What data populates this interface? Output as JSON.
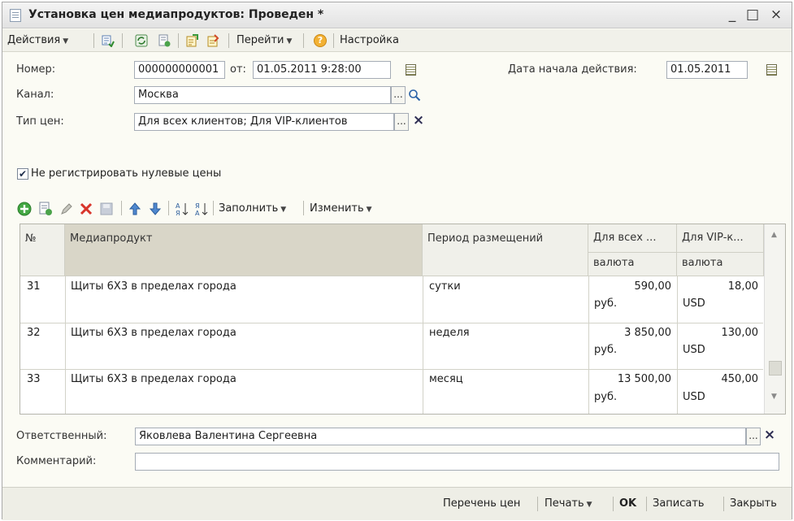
{
  "window": {
    "title": "Установка цен медиапродуктов: Проведен *",
    "minimize": "_",
    "maximize": "□",
    "close": "×"
  },
  "toolbar": {
    "actions_label": "Действия",
    "goto_label": "Перейти",
    "settings_label": "Настройка",
    "help_icon": "?"
  },
  "form": {
    "number_label": "Номер:",
    "number_value": "000000000001",
    "from_label": "от:",
    "date_value": "01.05.2011 9:28:00",
    "start_date_label": "Дата начала действия:",
    "start_date_value": "01.05.2011",
    "channel_label": "Канал:",
    "channel_value": "Москва",
    "price_type_label": "Тип цен:",
    "price_type_value": "Для всех клиентов; Для VIP-клиентов",
    "no_zero_label": "Не регистрировать нулевые цены",
    "no_zero_checked": true,
    "ellipsis": "...",
    "clear_icon": "×"
  },
  "table_toolbar": {
    "fill_label": "Заполнить",
    "change_label": "Изменить"
  },
  "grid": {
    "headers": {
      "num": "№",
      "product": "Медиапродукт",
      "period": "Период размещений",
      "all_clients": "Для всех ...",
      "vip_clients": "Для VIP-к...",
      "currency_1": "валюта",
      "currency_2": "валюта"
    },
    "rows": [
      {
        "num": "31",
        "product": "Щиты 6Х3 в пределах города",
        "period": "сутки",
        "all_price": "590,00",
        "all_cur": "руб.",
        "vip_price": "18,00",
        "vip_cur": "USD"
      },
      {
        "num": "32",
        "product": "Щиты 6Х3 в пределах города",
        "period": "неделя",
        "all_price": "3 850,00",
        "all_cur": "руб.",
        "vip_price": "130,00",
        "vip_cur": "USD"
      },
      {
        "num": "33",
        "product": "Щиты 6Х3 в пределах города",
        "period": "месяц",
        "all_price": "13 500,00",
        "all_cur": "руб.",
        "vip_price": "450,00",
        "vip_cur": "USD"
      }
    ]
  },
  "footer": {
    "responsible_label": "Ответственный:",
    "responsible_value": "Яковлева Валентина Сергеевна",
    "comment_label": "Комментарий:",
    "comment_value": ""
  },
  "bottom": {
    "price_list": "Перечень цен",
    "print": "Печать",
    "ok": "OK",
    "save": "Записать",
    "close": "Закрыть"
  },
  "colors": {
    "accent_green": "#3aa63a",
    "delete_red": "#d8342a",
    "window_bg": "#fbfbf4"
  }
}
